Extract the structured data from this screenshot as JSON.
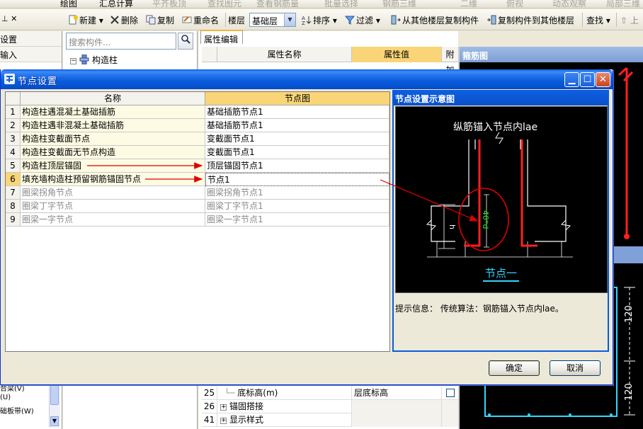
{
  "top_toolbar": {
    "items": [
      "绘图",
      "汇总计算",
      "平齐板顶",
      "查找图元",
      "查看钢筋量",
      "批量选择",
      "钢筋三维",
      "二维",
      "俯视",
      "动态观察",
      "局部三维"
    ]
  },
  "toolbar": {
    "new_label": "新建",
    "delete_label": "删除",
    "copy_label": "复制",
    "rename_label": "重命名",
    "floor_label": "楼层",
    "floor_value": "基础层",
    "sort_label": "排序",
    "filter_label": "过滤",
    "copy_from_label": "从其他楼层复制构件",
    "copy_to_label": "复制构件到其他楼层",
    "find_label": "查找",
    "up_label": "上"
  },
  "left_panel": {
    "items": [
      "设置",
      "输入"
    ],
    "bottom_items": [
      "合梁(V)",
      "(U)",
      "础板带(W)"
    ]
  },
  "tree_panel": {
    "search_placeholder": "搜索构件...",
    "root_label": "构造柱"
  },
  "property_panel": {
    "tab_label": "属性编辑",
    "col_name": "属性名称",
    "col_value": "属性值",
    "col_extra": "附加",
    "rows": [
      {
        "num": "25",
        "name": "底标高(m)",
        "value": "层底标高"
      },
      {
        "num": "26",
        "name": "锚固搭接",
        "value": ""
      },
      {
        "num": "41",
        "name": "显示样式",
        "value": ""
      }
    ]
  },
  "rebar_panel": {
    "title": "箍筋图",
    "dim_label_1": "120",
    "dim_label_2": "120"
  },
  "dialog": {
    "title": "节点设置",
    "col_name": "名称",
    "col_node": "节点图",
    "rows": [
      {
        "num": "1",
        "name": "构造柱遇混凝土基础插筋",
        "node": "基础插筋节点1",
        "enabled": true
      },
      {
        "num": "2",
        "name": "构造柱遇非混凝土基础插筋",
        "node": "基础插筋节点1",
        "enabled": true
      },
      {
        "num": "3",
        "name": "构造柱变截面节点",
        "node": "变截面节点1",
        "enabled": true
      },
      {
        "num": "4",
        "name": "构造柱变截面无节点构造",
        "node": "变截面节点1",
        "enabled": true
      },
      {
        "num": "5",
        "name": "构造柱顶层锚固",
        "node": "顶层锚固节点1",
        "enabled": true
      },
      {
        "num": "6",
        "name": "填充墙构造柱预留钢筋锚固节点",
        "node": "节点1",
        "enabled": true,
        "selected": true
      },
      {
        "num": "7",
        "name": "圈梁拐角节点",
        "node": "圈梁拐角节点1",
        "enabled": false
      },
      {
        "num": "8",
        "name": "圈梁丁字节点",
        "node": "圈梁丁字节点1",
        "enabled": false
      },
      {
        "num": "9",
        "name": "圈梁一字节点",
        "node": "圈梁一字节点1",
        "enabled": false
      }
    ],
    "preview_title": "节点设置示意图",
    "diagram_caption": "纵筋锚入节点内lae",
    "diagram_dim": "40*d",
    "diagram_h": "h",
    "diagram_node_label": "节点一",
    "hint_label": "提示信息：",
    "hint_text": "传统算法：钢筋锚入节点内lae。",
    "ok_label": "确定",
    "cancel_label": "取消"
  },
  "colors": {
    "titlebar": "#0a5bdc",
    "rebar_red": "#ff2020",
    "annotation_red": "#e00000",
    "diagram_cyan": "#33d6ff",
    "diagram_green": "#22ee22"
  }
}
